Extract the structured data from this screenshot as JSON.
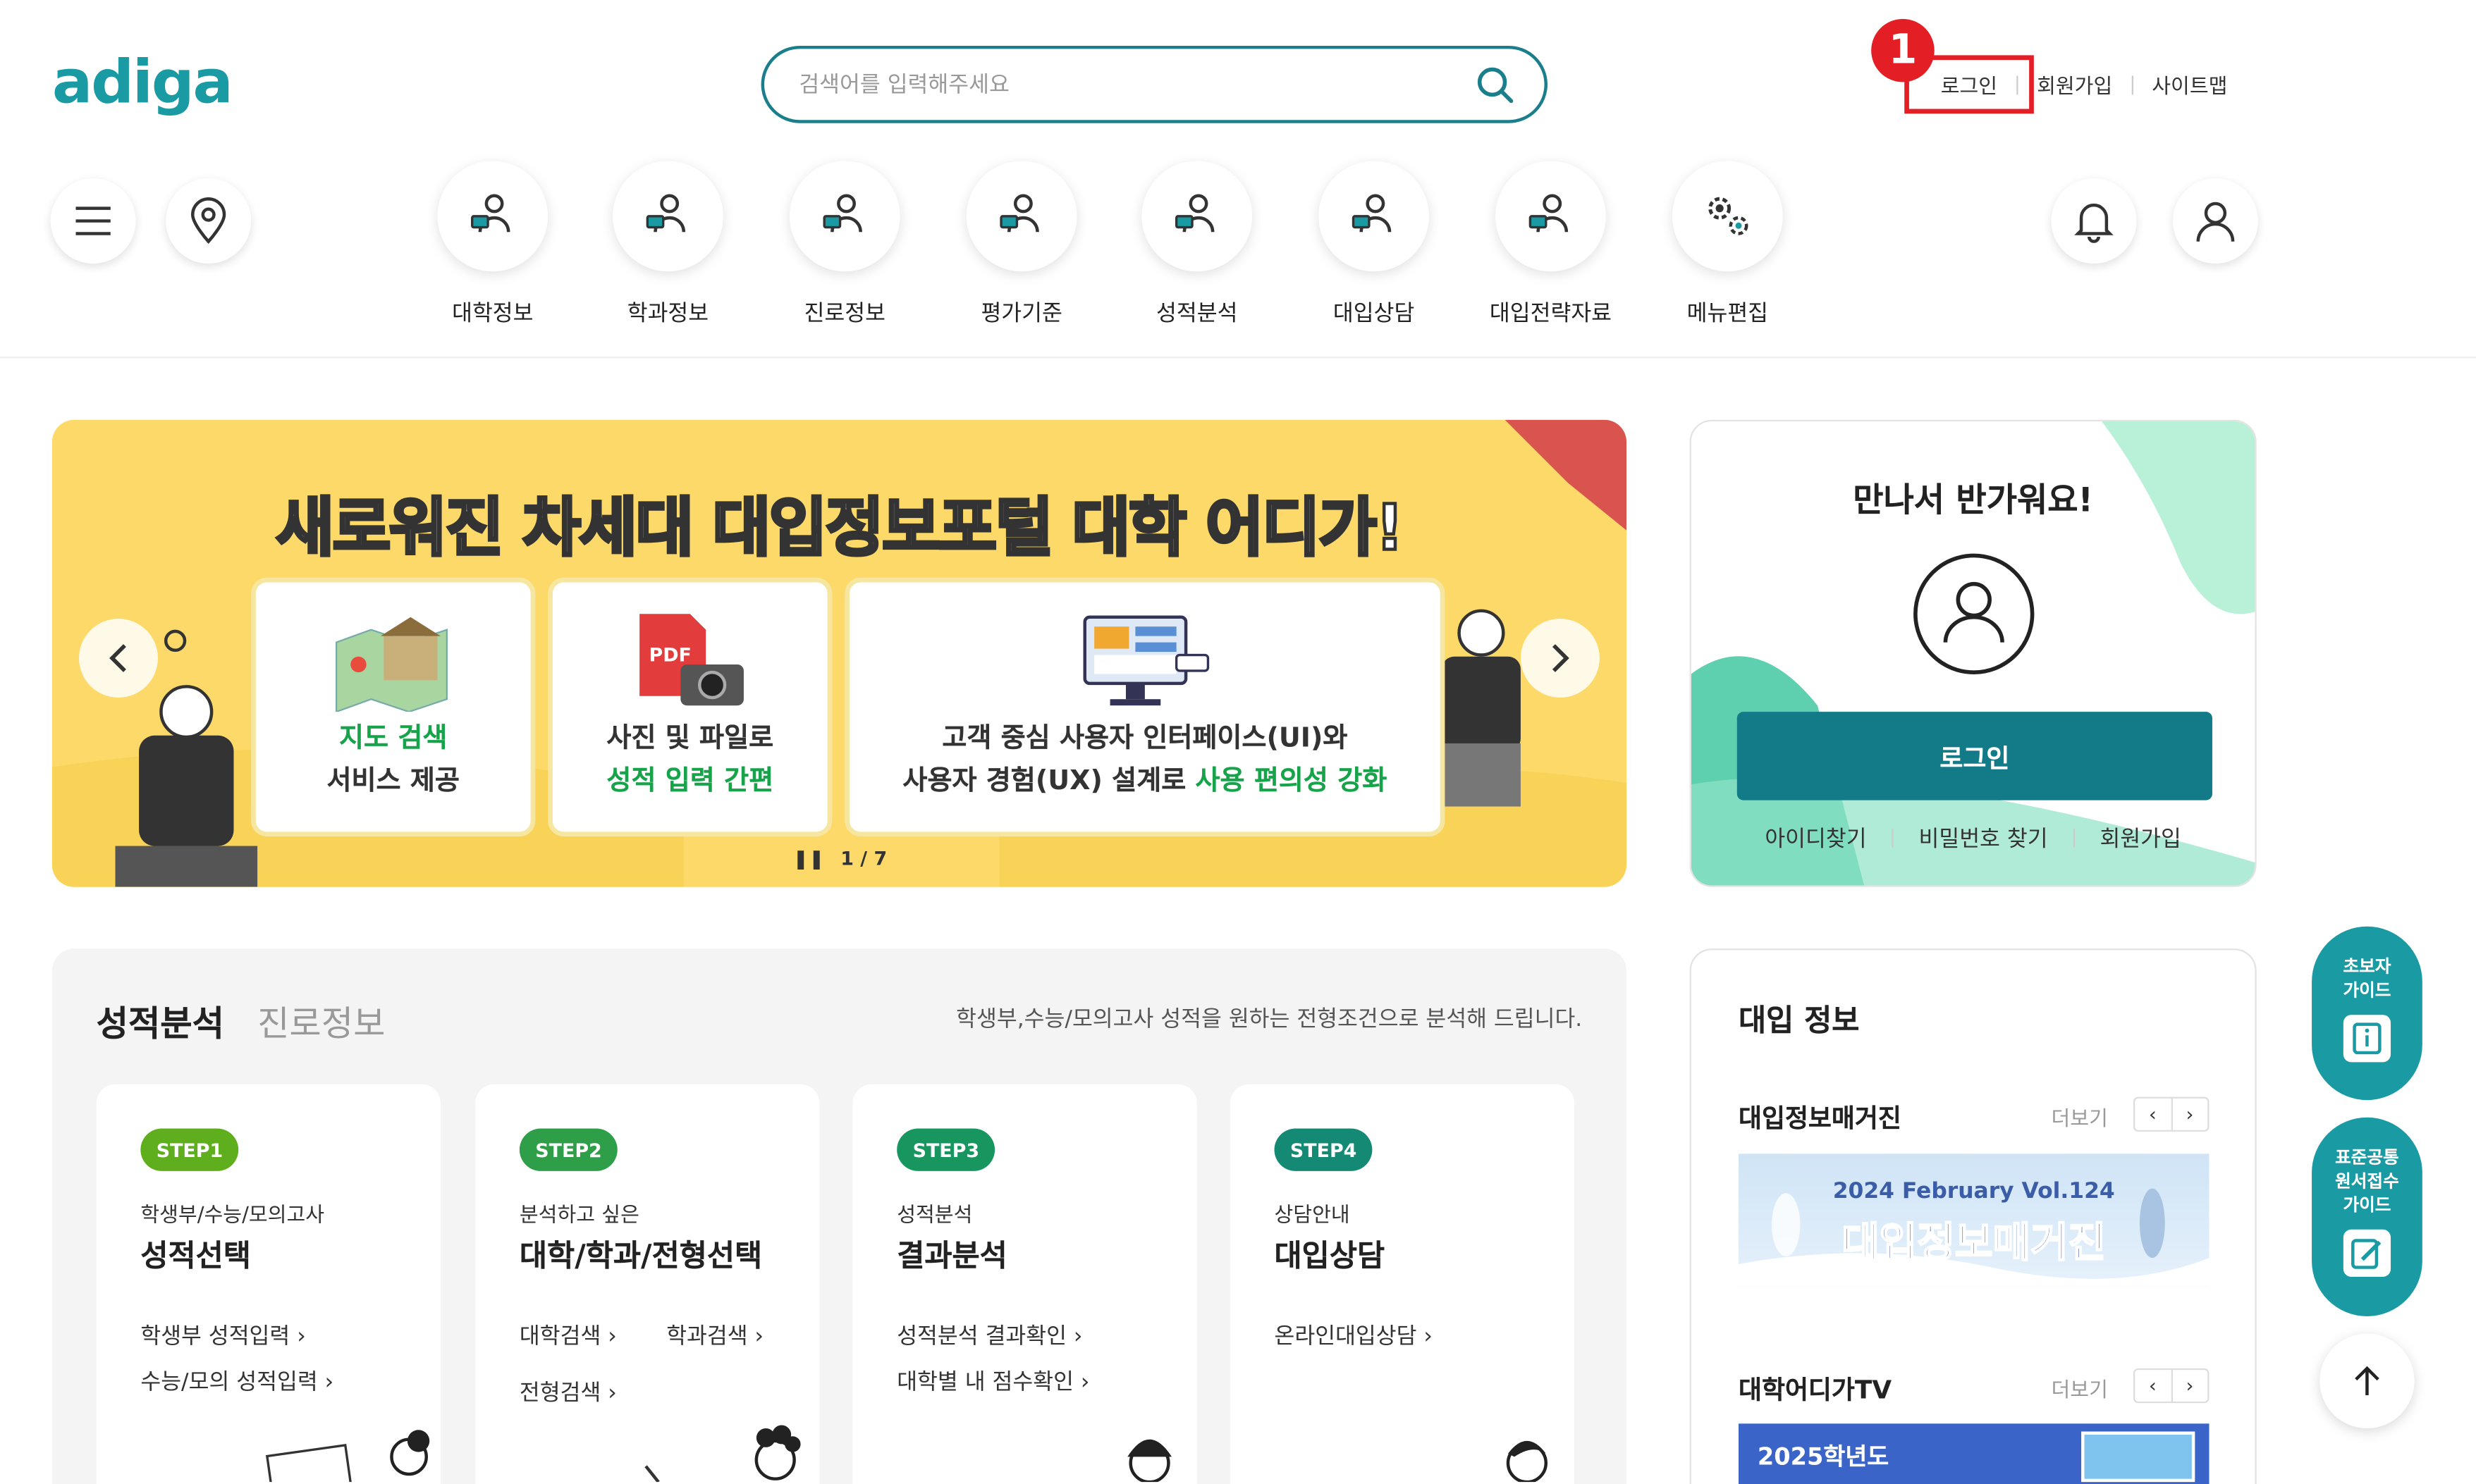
{
  "header": {
    "logo": "adiga",
    "search_placeholder": "검색어를 입력해주세요",
    "links": {
      "login": "로그인",
      "signup": "회원가입",
      "sitemap": "사이트맵"
    },
    "annotation_number": "1"
  },
  "nav": {
    "items": [
      {
        "label": "대학정보",
        "icon": "person-board-icon"
      },
      {
        "label": "학과정보",
        "icon": "person-board-icon"
      },
      {
        "label": "진로정보",
        "icon": "person-board-icon"
      },
      {
        "label": "평가기준",
        "icon": "person-board-icon"
      },
      {
        "label": "성적분석",
        "icon": "person-board-icon"
      },
      {
        "label": "대입상담",
        "icon": "person-board-icon"
      },
      {
        "label": "대입전략자료",
        "icon": "person-board-icon"
      },
      {
        "label": "메뉴편집",
        "icon": "gears-icon"
      }
    ]
  },
  "banner": {
    "title": "새로워진 차세대 대입정보포털 대학 어디가!",
    "cards": [
      {
        "line1": "지도 검색",
        "line2": "서비스 제공"
      },
      {
        "line1": "사진 및 파일로",
        "line2": "성적 입력 간편"
      },
      {
        "line1": "고객 중심 사용자 인터페이스(UI)와",
        "line2_pre": "사용자 경험(UX) 설계로 ",
        "line2_hl": "사용 편의성 강화"
      }
    ],
    "pager": "1 / 7",
    "pdf_label": "PDF"
  },
  "login_card": {
    "greeting": "만나서 반가워요!",
    "login_button": "로그인",
    "find_id": "아이디찾기",
    "find_pw": "비밀번호 찾기",
    "signup": "회원가입"
  },
  "analysis": {
    "tab_active": "성적분석",
    "tab_inactive": "진로정보",
    "description": "학생부,수능/모의고사 성적을 원하는 전형조건으로 분석해 드립니다.",
    "steps": [
      {
        "badge": "STEP1",
        "color": "#5fae1e",
        "sub": "학생부/수능/모의고사",
        "main": "성적선택",
        "links": [
          "학생부 성적입력 ›",
          "수능/모의 성적입력 ›"
        ]
      },
      {
        "badge": "STEP2",
        "color": "#2e9e48",
        "sub": "분석하고 싶은",
        "main": "대학/학과/전형선택",
        "links": [
          "대학검색 ›",
          "학과검색 ›",
          "전형검색 ›"
        ]
      },
      {
        "badge": "STEP3",
        "color": "#179660",
        "sub": "성적분석",
        "main": "결과분석",
        "links": [
          "성적분석 결과확인 ›",
          "대학별 내 점수확인 ›"
        ]
      },
      {
        "badge": "STEP4",
        "color": "#148a74",
        "sub": "상담안내",
        "main": "대입상담",
        "links": [
          "온라인대입상담 ›"
        ]
      }
    ]
  },
  "info": {
    "title": "대입 정보",
    "magazine": {
      "label": "대입정보매거진",
      "more": "더보기",
      "issue": "2024 February Vol.124",
      "banner_title": "대입정보매거진"
    },
    "tv": {
      "label": "대학어디가TV",
      "more": "더보기",
      "banner_text": "2025학년도"
    }
  },
  "floating": {
    "beginner_guide": "초보자\n가이드",
    "common_guide": "표준공통\n원서접수\n가이드"
  },
  "colors": {
    "brand": "#1a9aa3",
    "primary_button": "#137a87",
    "highlight": "#e41e25",
    "banner_bg": "#fcd968"
  }
}
